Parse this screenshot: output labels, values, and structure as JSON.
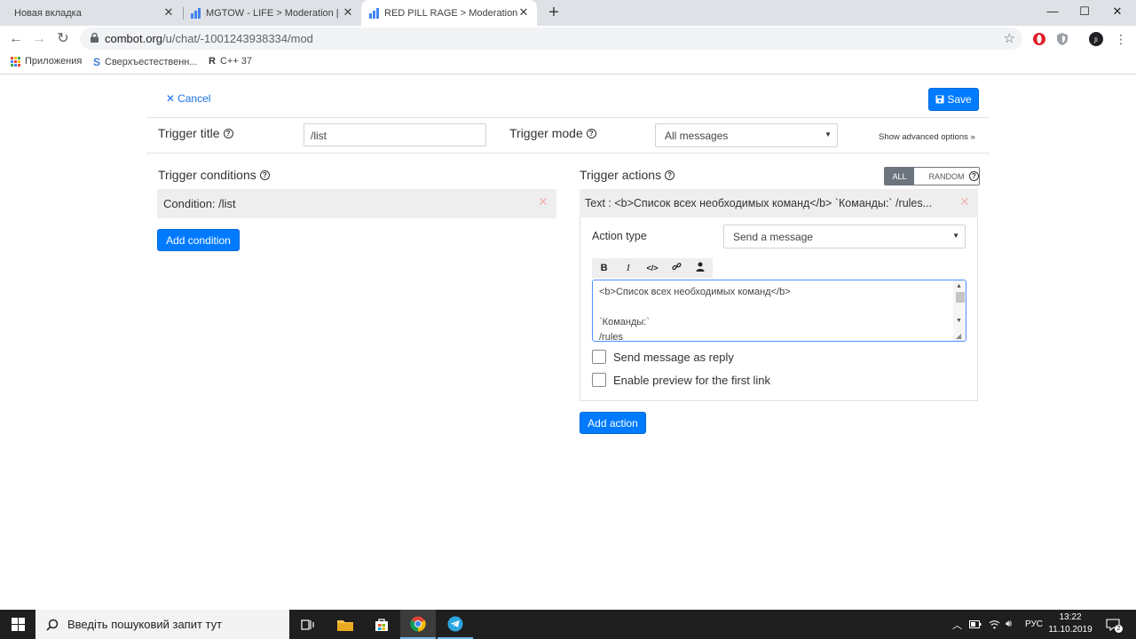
{
  "browser": {
    "tabs": [
      {
        "title": "Новая вкладка"
      },
      {
        "title": "MGTOW - LIFE > Moderation | Co"
      },
      {
        "title": "RED PILL RAGE > Moderation | C"
      }
    ],
    "url_host": "combot.org",
    "url_path": "/u/chat/-1001243938334/mod",
    "bookmarks": [
      "Приложения",
      "Сверхъестественн...",
      "C++ 37"
    ]
  },
  "header": {
    "cancel_label": "Cancel",
    "save_label": "Save"
  },
  "trigger": {
    "title_label": "Trigger title",
    "title_value": "/list",
    "mode_label": "Trigger mode",
    "mode_value": "All messages",
    "advanced_link": "Show advanced options »"
  },
  "conditions": {
    "heading": "Trigger conditions",
    "items": [
      {
        "text": "Condition: /list"
      }
    ],
    "add_label": "Add condition"
  },
  "actions": {
    "heading": "Trigger actions",
    "mode_options": [
      "ALL",
      "RANDOM"
    ],
    "active_mode": "ALL",
    "items": [
      {
        "summary": "Text : <b>Список всех необходимых команд</b> `Команды:` /rules...",
        "type_label": "Action type",
        "type_value": "Send a message",
        "text": "<b>Список всех необходимых команд</b>\n\n`Команды:`\n/rules",
        "reply_label": "Send message as reply",
        "preview_label": "Enable preview for the first link"
      }
    ],
    "add_label": "Add action"
  },
  "taskbar": {
    "search_placeholder": "Введіть пошуковий запит тут",
    "lang": "РУС",
    "time": "13:22",
    "date": "11.10.2019",
    "notification_count": "2"
  }
}
